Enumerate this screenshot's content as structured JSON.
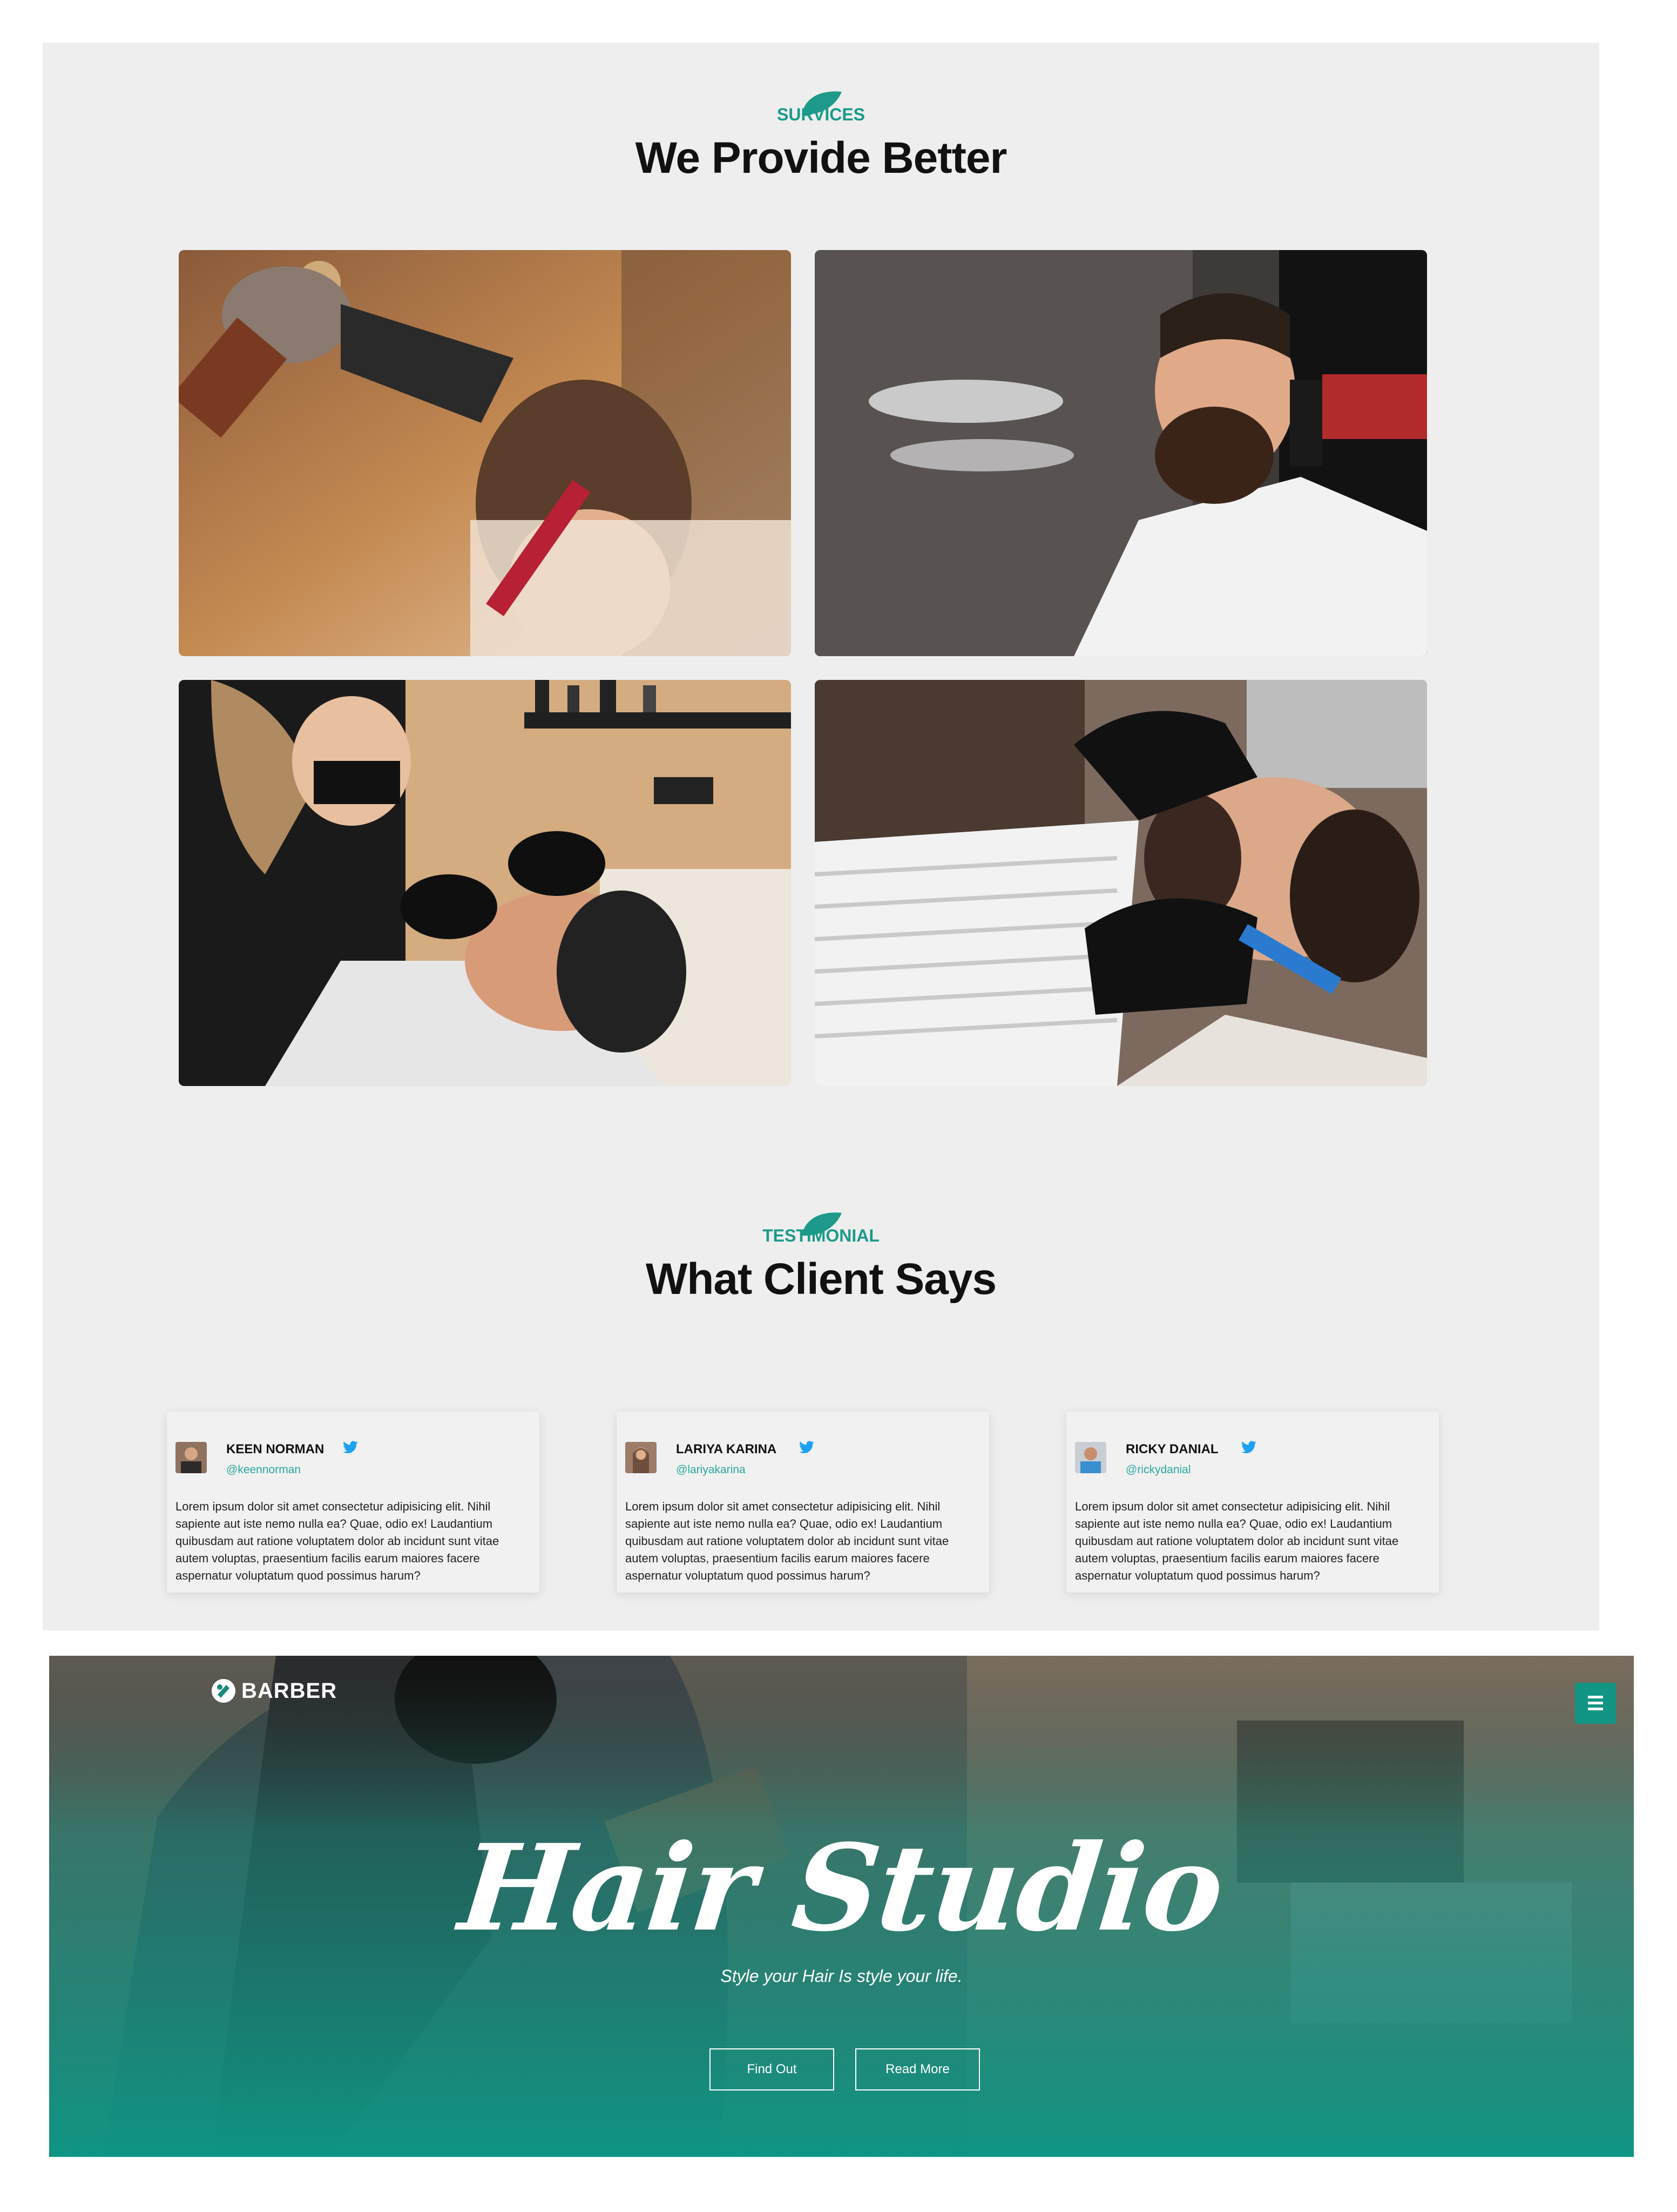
{
  "services": {
    "badge": "SURVICES",
    "title": "We Provide Better"
  },
  "testimonial": {
    "badge": "TESTIMONIAL",
    "title": "What Client Says",
    "cards": [
      {
        "name": "KEEN NORMAN",
        "handle": "@keennorman",
        "text": "Lorem ipsum dolor sit amet consectetur adipisicing elit. Nihil sapiente aut iste nemo nulla ea? Quae, odio ex! Laudantium quibusdam aut ratione voluptatem dolor ab incidunt sunt vitae autem voluptas, praesentium facilis earum maiores facere aspernatur voluptatum quod possimus harum?"
      },
      {
        "name": "LARIYA KARINA",
        "handle": "@lariyakarina",
        "text": "Lorem ipsum dolor sit amet consectetur adipisicing elit. Nihil sapiente aut iste nemo nulla ea? Quae, odio ex! Laudantium quibusdam aut ratione voluptatem dolor ab incidunt sunt vitae autem voluptas, praesentium facilis earum maiores facere aspernatur voluptatum quod possimus harum?"
      },
      {
        "name": "RICKY DANIAL",
        "handle": "@rickydanial",
        "text": "Lorem ipsum dolor sit amet consectetur adipisicing elit. Nihil sapiente aut iste nemo nulla ea? Quae, odio ex! Laudantium quibusdam aut ratione voluptatem dolor ab incidunt sunt vitae autem voluptas, praesentium facilis earum maiores facere aspernatur voluptatum quod possimus harum?"
      }
    ]
  },
  "hero": {
    "logo": "BARBER",
    "title": "Hair Studio",
    "subtitle": "Style your Hair Is style your life.",
    "buttons": [
      "Find Out",
      "Read More"
    ]
  },
  "colors": {
    "accent": "#139583",
    "panel_bg": "#eeeeee",
    "twitter": "#1da1f2"
  },
  "icons": [
    "leaf-icon",
    "twitter-bird-icon",
    "barber-logo-icon",
    "hamburger-menu-icon"
  ]
}
